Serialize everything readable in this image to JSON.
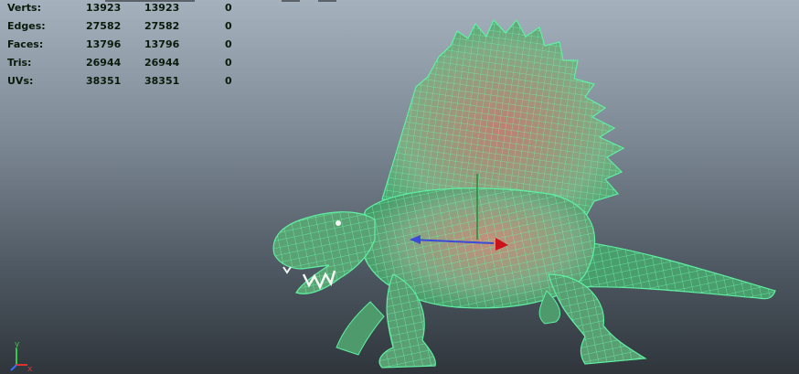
{
  "hud": {
    "rows": [
      {
        "label": "Verts:",
        "values": [
          "13923",
          "13923",
          "0"
        ]
      },
      {
        "label": "Edges:",
        "values": [
          "27582",
          "27582",
          "0"
        ]
      },
      {
        "label": "Faces:",
        "values": [
          "13796",
          "13796",
          "0"
        ]
      },
      {
        "label": "Tris:",
        "values": [
          "26944",
          "26944",
          "0"
        ]
      },
      {
        "label": "UVs:",
        "values": [
          "38351",
          "38351",
          "0"
        ]
      }
    ]
  },
  "axis": {
    "y": "y",
    "x": "x"
  },
  "colors": {
    "wireframe": "#5ef0a2",
    "bg_top": "#a5b1bd",
    "bg_bottom": "#2f353b",
    "hud_text": "#0b1a0b"
  },
  "icons": [
    "axis-gizmo-icon",
    "manipulator-icon"
  ]
}
